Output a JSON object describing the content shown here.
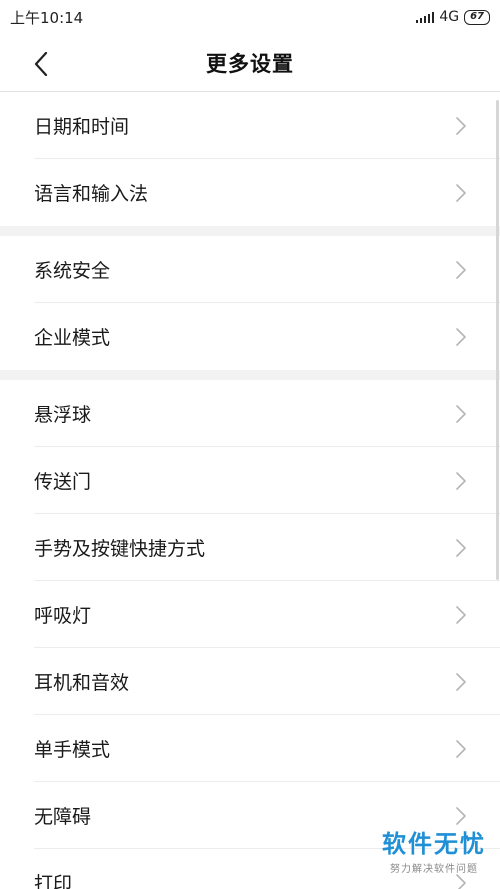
{
  "status_bar": {
    "time": "上午10:14",
    "network": "4G",
    "battery": "67"
  },
  "header": {
    "title": "更多设置"
  },
  "groups": [
    {
      "items": [
        {
          "label": "日期和时间"
        },
        {
          "label": "语言和输入法"
        }
      ]
    },
    {
      "items": [
        {
          "label": "系统安全"
        },
        {
          "label": "企业模式"
        }
      ]
    },
    {
      "items": [
        {
          "label": "悬浮球"
        },
        {
          "label": "传送门"
        },
        {
          "label": "手势及按键快捷方式"
        },
        {
          "label": "呼吸灯"
        },
        {
          "label": "耳机和音效"
        },
        {
          "label": "单手模式"
        },
        {
          "label": "无障碍"
        },
        {
          "label": "打印"
        }
      ]
    }
  ],
  "watermark": {
    "title": "软件无忧",
    "subtitle": "努力解决软件问题"
  },
  "icons": {
    "back": "chevron-left-icon",
    "row": "chevron-right-icon"
  },
  "colors": {
    "watermark": "#1f8fd6",
    "chevron": "#b5b5b5"
  }
}
